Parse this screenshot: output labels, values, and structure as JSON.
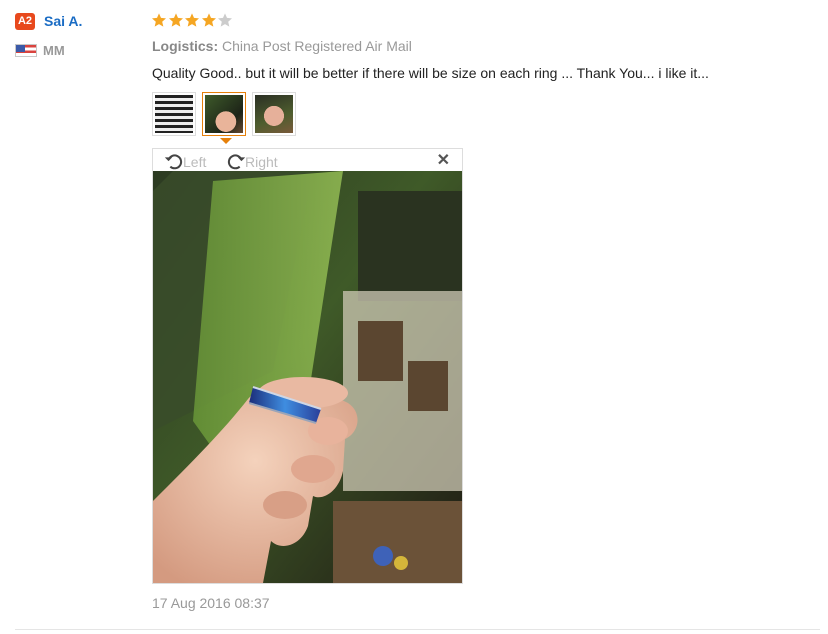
{
  "reviewer": {
    "badge": "A2",
    "name": "Sai A.",
    "country": "MM"
  },
  "rating": {
    "value": 4,
    "max": 5,
    "filled_color": "#f5a623",
    "empty_color": "#cccccc"
  },
  "logistics": {
    "label": "Logistics:",
    "value": "China Post Registered Air Mail"
  },
  "review": {
    "text": "Quality Good.. but it will be better if there will be size on each ring ... Thank You... i like it..."
  },
  "thumbnails": [
    {
      "icon": "fabric-photo",
      "active": false
    },
    {
      "icon": "hand-ring-photo",
      "active": true
    },
    {
      "icon": "hand-ring-photo-2",
      "active": false
    }
  ],
  "viewer": {
    "rotate_left_label": "Left",
    "rotate_right_label": "Right",
    "close_icon": "close-icon"
  },
  "timestamp": "17 Aug 2016 08:37",
  "colors": {
    "accent": "#e6800a",
    "link": "#1a6cc4",
    "badge": "#e8491d"
  }
}
